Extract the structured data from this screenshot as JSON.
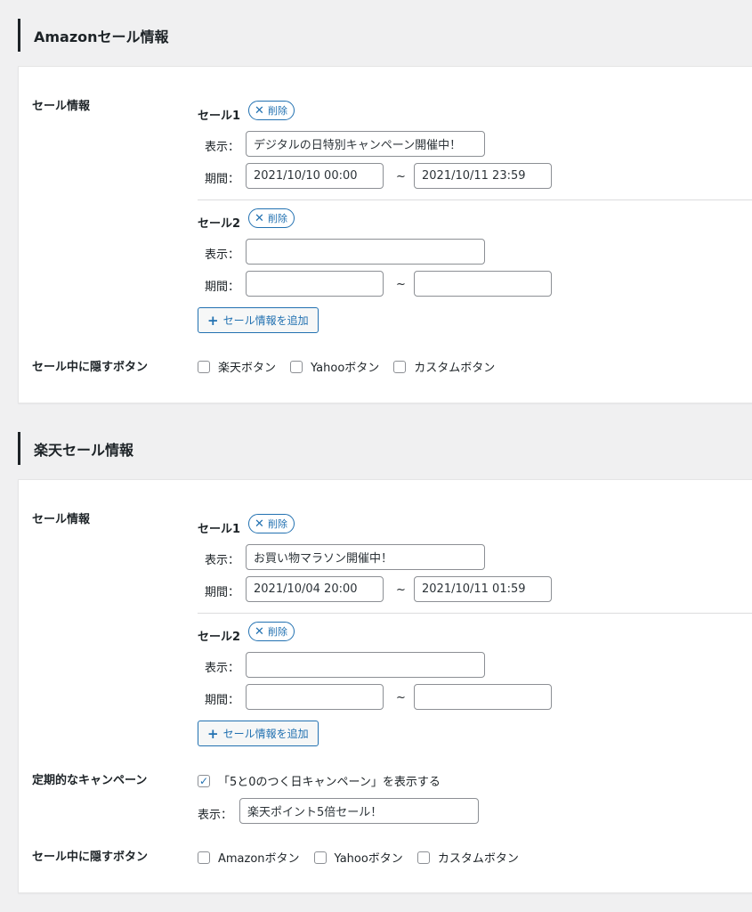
{
  "amazon": {
    "title": "Amazonセール情報",
    "sale_info_label": "セール情報",
    "sales": [
      {
        "title": "セール1",
        "delete_label": "削除",
        "display_label": "表示：",
        "display_value": "デジタルの日特別キャンペーン開催中！",
        "period_label": "期間：",
        "start": "2021/10/10 00:00",
        "tilde": "~",
        "end": "2021/10/11 23:59"
      },
      {
        "title": "セール2",
        "delete_label": "削除",
        "display_label": "表示：",
        "display_value": "",
        "period_label": "期間：",
        "start": "",
        "tilde": "~",
        "end": ""
      }
    ],
    "add_label": "セール情報を追加",
    "hide_label": "セール中に隠すボタン",
    "hide_options": [
      {
        "label": "楽天ボタン",
        "checked": false
      },
      {
        "label": "Yahooボタン",
        "checked": false
      },
      {
        "label": "カスタムボタン",
        "checked": false
      }
    ]
  },
  "rakuten": {
    "title": "楽天セール情報",
    "sale_info_label": "セール情報",
    "sales": [
      {
        "title": "セール1",
        "delete_label": "削除",
        "display_label": "表示：",
        "display_value": "お買い物マラソン開催中！",
        "period_label": "期間：",
        "start": "2021/10/04 20:00",
        "tilde": "~",
        "end": "2021/10/11 01:59"
      },
      {
        "title": "セール2",
        "delete_label": "削除",
        "display_label": "表示：",
        "display_value": "",
        "period_label": "期間：",
        "start": "",
        "tilde": "~",
        "end": ""
      }
    ],
    "add_label": "セール情報を追加",
    "campaign_label": "定期的なキャンペーン",
    "campaign_check_label": "「5と0のつく日キャンペーン」を表示する",
    "campaign_checked": true,
    "campaign_display_label": "表示：",
    "campaign_display_value": "楽天ポイント5倍セール！",
    "hide_label": "セール中に隠すボタン",
    "hide_options": [
      {
        "label": "Amazonボタン",
        "checked": false
      },
      {
        "label": "Yahooボタン",
        "checked": false
      },
      {
        "label": "カスタムボタン",
        "checked": false
      }
    ]
  },
  "icons": {
    "delete": "close-icon",
    "add": "plus-icon",
    "check": "checkmark-icon"
  },
  "colors": {
    "accent": "#2271b1",
    "background": "#f0f0f1",
    "text": "#1d2327"
  }
}
